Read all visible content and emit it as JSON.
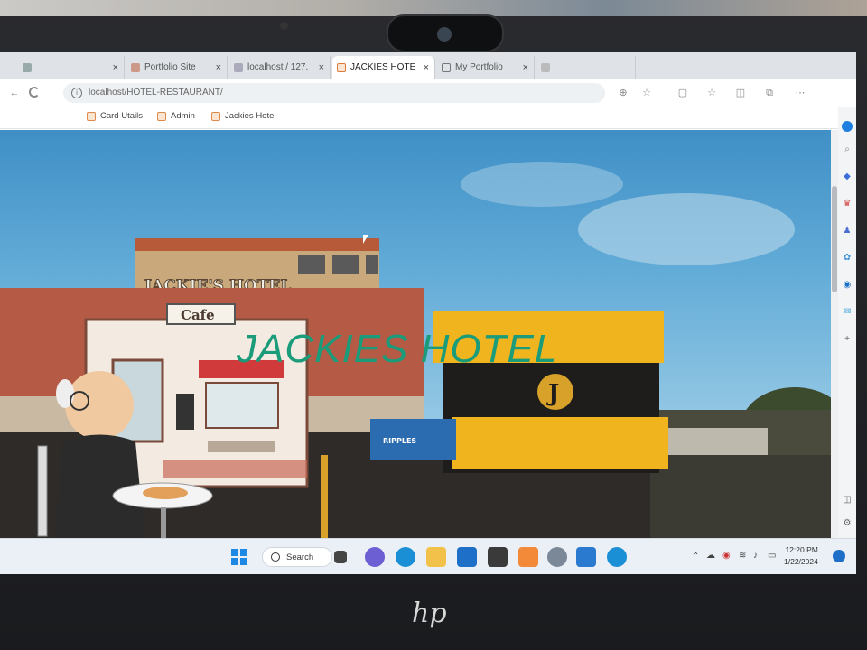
{
  "browser": {
    "tabs": [
      {
        "label": "",
        "active": false
      },
      {
        "label": "Portfolio Site",
        "active": false
      },
      {
        "label": "localhost / 127.",
        "active": false
      },
      {
        "label": "JACKIES HOTE",
        "active": true
      },
      {
        "label": "My Portfolio",
        "active": false
      },
      {
        "label": "",
        "active": false
      }
    ],
    "tab_close": "×",
    "address": "localhost/HOTEL-RESTAURANT/",
    "bookmarks": [
      "Card Utails",
      "Admin",
      "Jackies Hotel"
    ]
  },
  "page": {
    "hero_title": "JACKIES HOTEL",
    "sign_hotel": "JACKIE'S HOTEL",
    "sign_cafe": "Cafe",
    "sign_j": "J",
    "banner": "RIPPLES"
  },
  "taskbar": {
    "search_label": "Search",
    "time": "12:20 PM",
    "date": "1/22/2024"
  },
  "colors": {
    "accent_title": "#1a9b7a",
    "awning_yellow": "#f0b51e",
    "sky": "#5aa7d6"
  }
}
